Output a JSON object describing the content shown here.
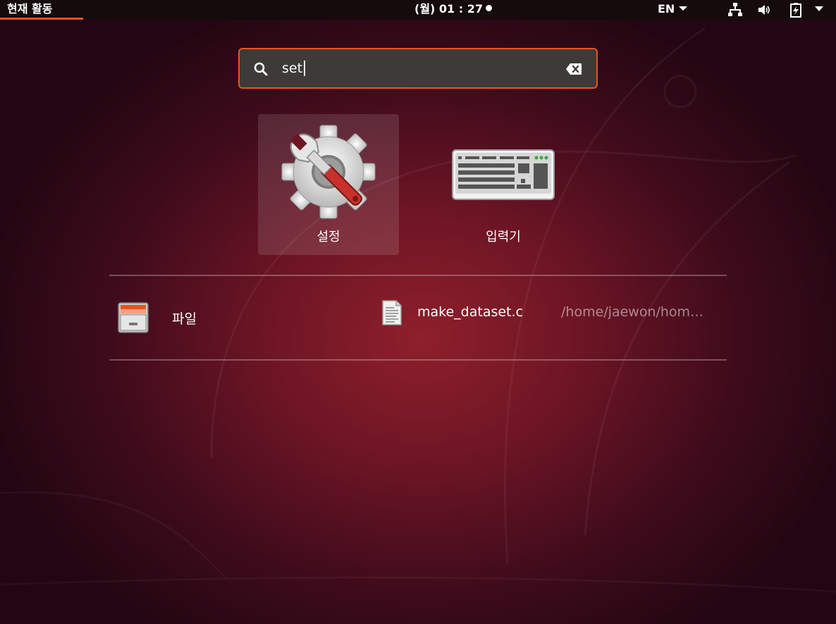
{
  "topbar": {
    "activities_label": "현재 활동",
    "clock": "(월) 01 : 27",
    "language": "EN"
  },
  "icons": {
    "network": "network-wired-icon",
    "volume": "volume-icon",
    "battery": "battery-charging-icon",
    "menu": "chevron-down-icon"
  },
  "search": {
    "value": "set",
    "placeholder": ""
  },
  "apps": [
    {
      "label": "설정",
      "icon": "settings-gear-wrench-icon",
      "selected": true
    },
    {
      "label": "입력기",
      "icon": "keyboard-icon",
      "selected": false
    }
  ],
  "results": [
    {
      "name": "파일",
      "icon": "file-cabinet-icon"
    },
    {
      "name": "make_dataset.c",
      "path": "/home/jaewon/hom…",
      "icon": "text-file-icon"
    }
  ],
  "colors": {
    "accent": "#e95420",
    "topbar": "#150a0c",
    "search_bg": "#3c3b37"
  }
}
